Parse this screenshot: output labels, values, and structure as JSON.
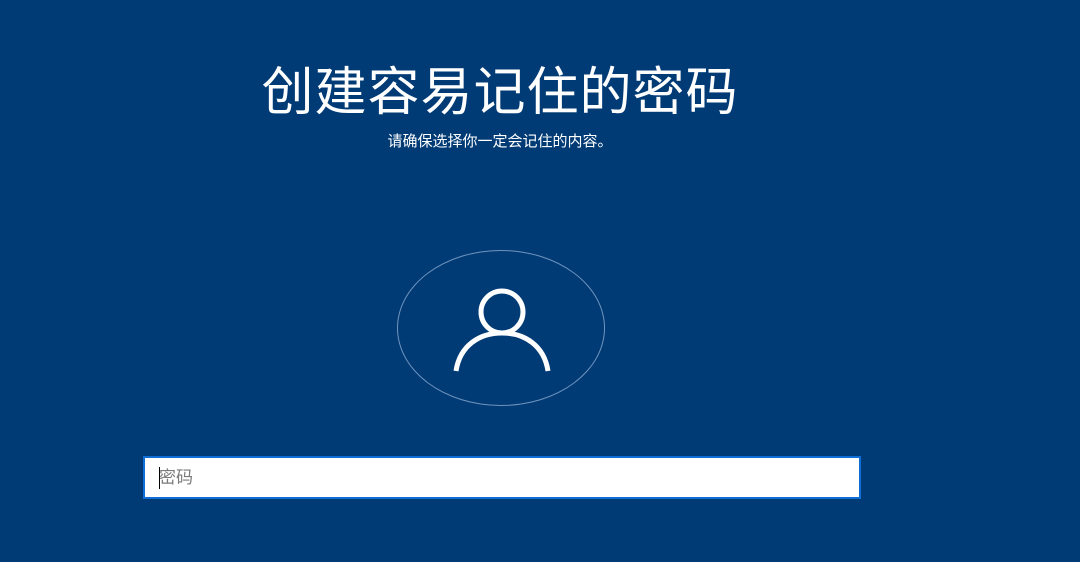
{
  "page": {
    "title": "创建容易记住的密码",
    "subtitle": "请确保选择你一定会记住的内容。"
  },
  "avatar": {
    "icon": "user-icon"
  },
  "password": {
    "placeholder": "密码",
    "value": ""
  },
  "colors": {
    "background": "#013b76",
    "text": "#ffffff",
    "input_border": "#0f6ed6",
    "avatar_ring": "#6f94bd"
  }
}
